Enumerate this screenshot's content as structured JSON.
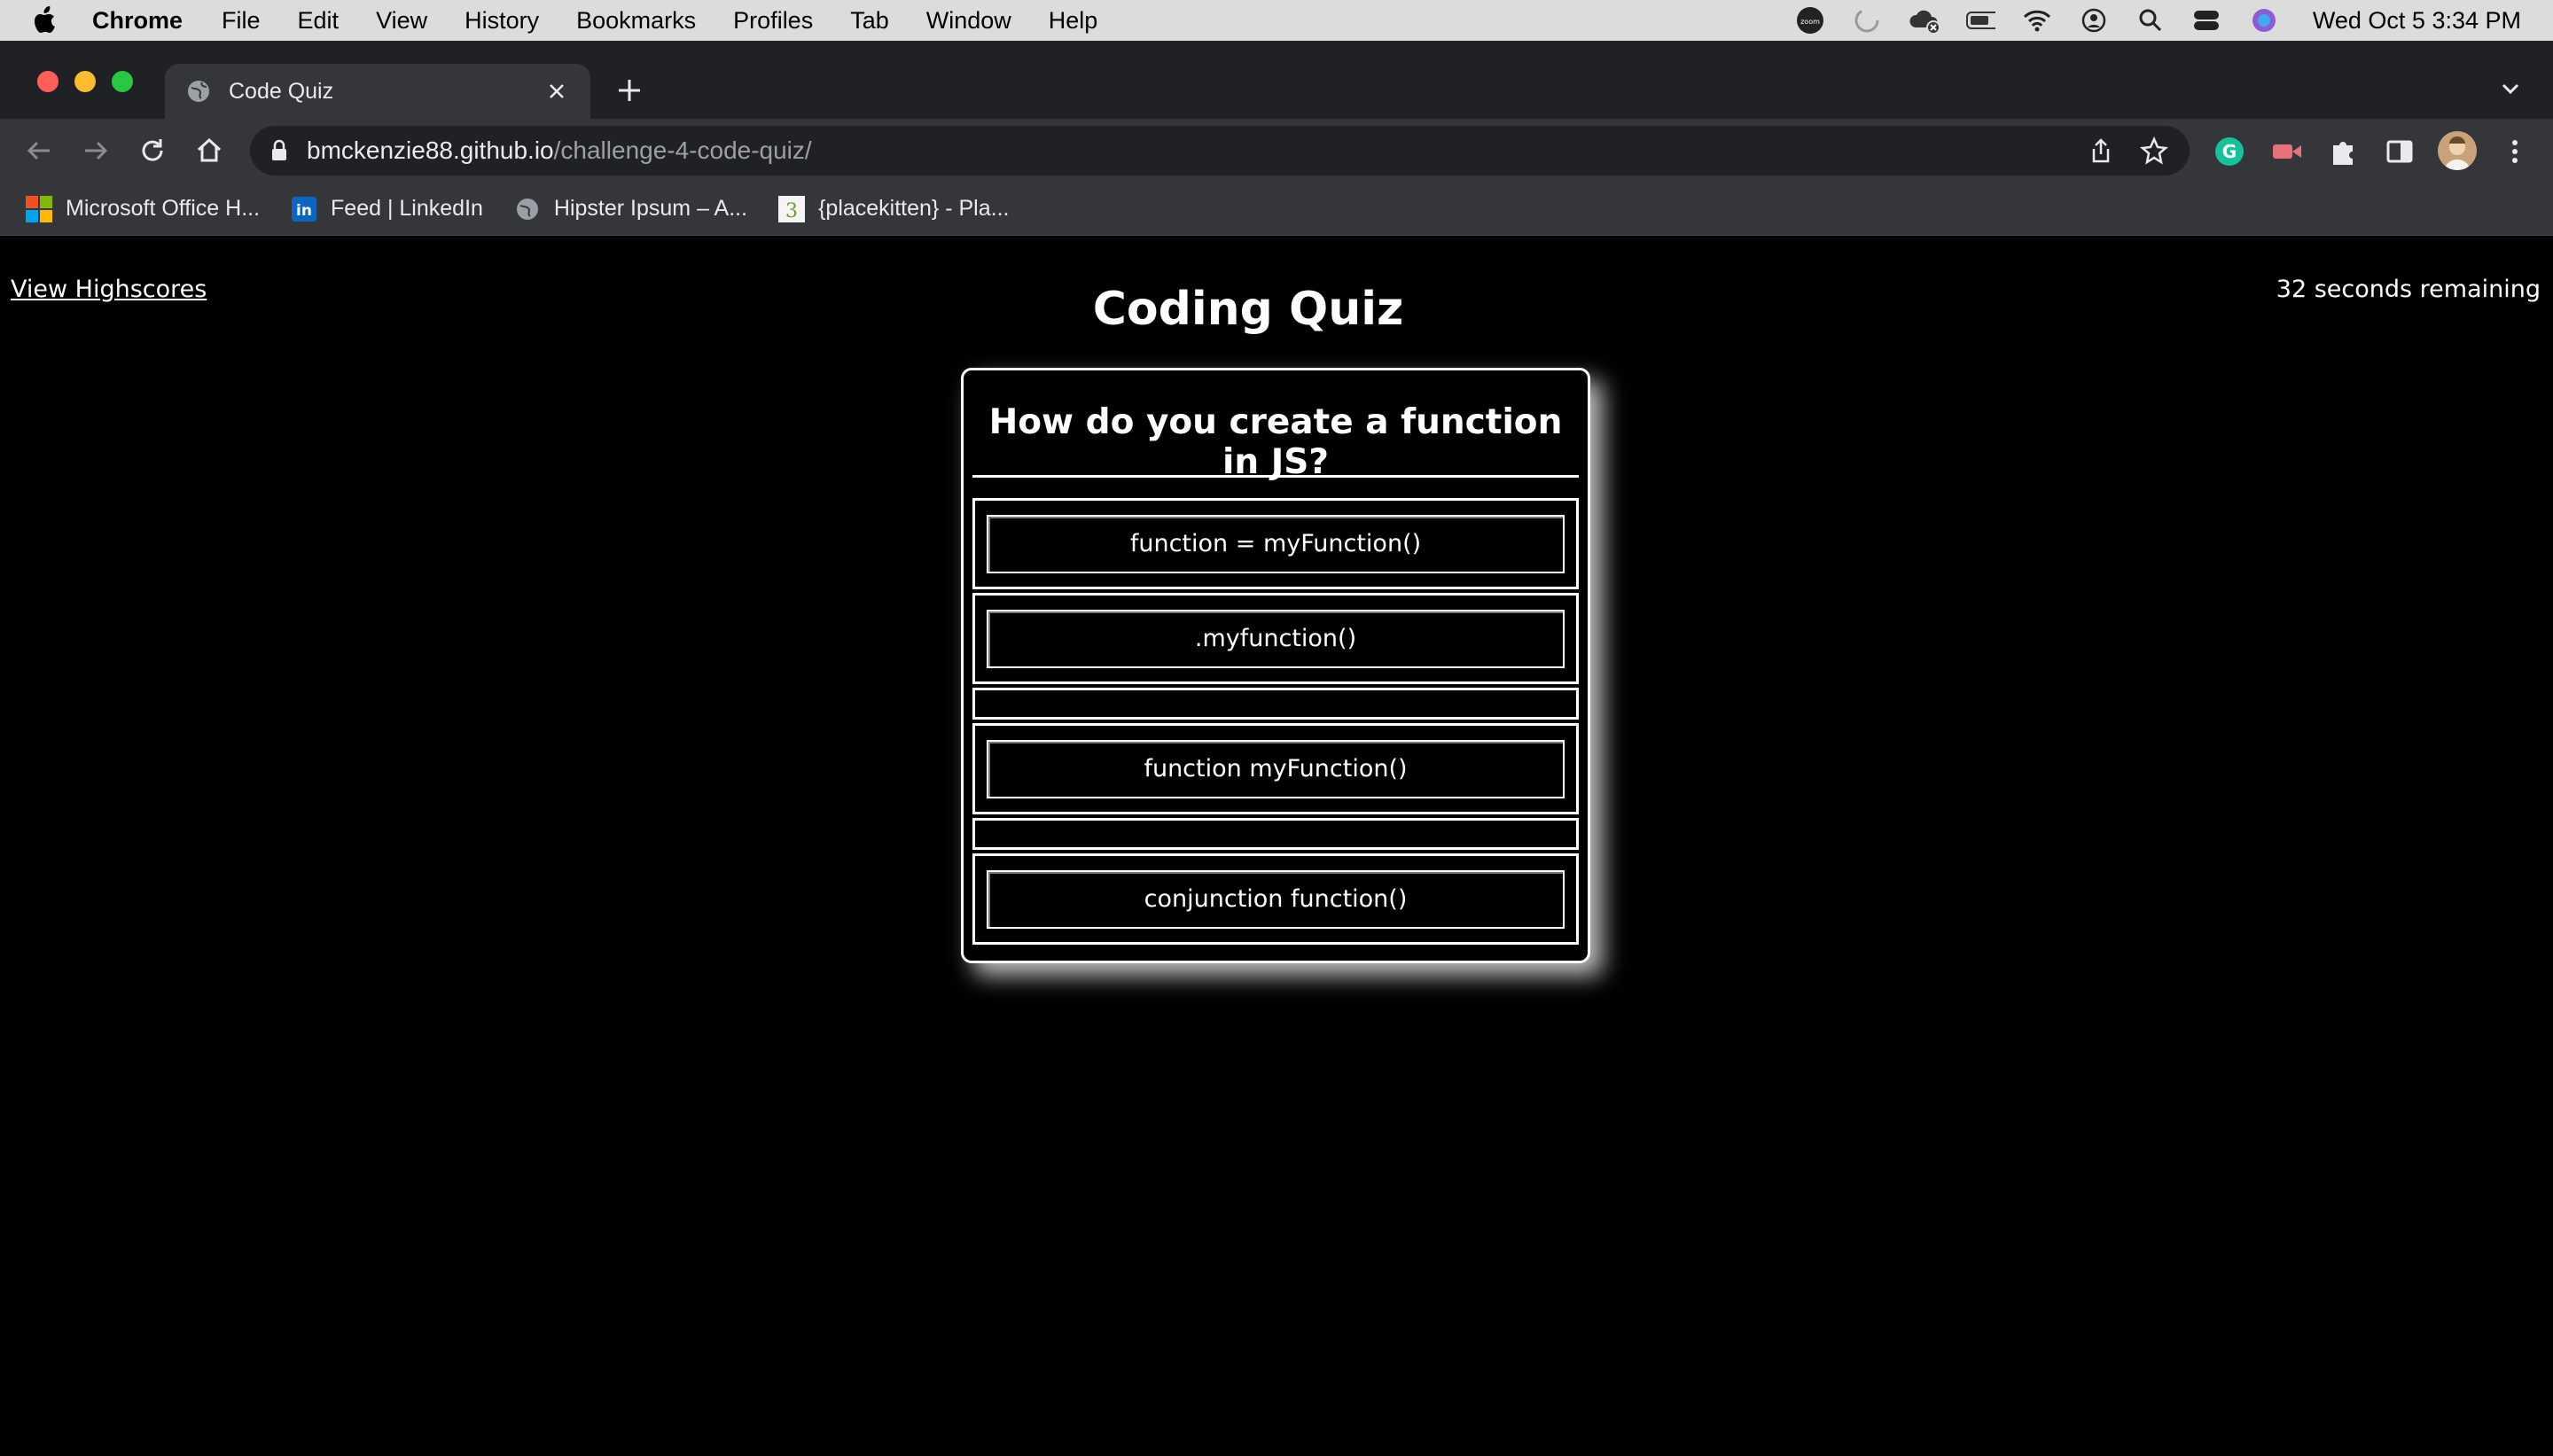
{
  "menubar": {
    "app": "Chrome",
    "items": [
      "File",
      "Edit",
      "View",
      "History",
      "Bookmarks",
      "Profiles",
      "Tab",
      "Window",
      "Help"
    ],
    "clock": "Wed Oct 5  3:34 PM"
  },
  "browser": {
    "tab_title": "Code Quiz",
    "url_host": "bmckenzie88.github.io",
    "url_path": "/challenge-4-code-quiz/",
    "bookmarks": [
      {
        "label": "Microsoft Office H...",
        "icon": "microsoft-icon"
      },
      {
        "label": "Feed | LinkedIn",
        "icon": "linkedin-icon"
      },
      {
        "label": "Hipster Ipsum – A...",
        "icon": "globe-icon"
      },
      {
        "label": "{placekitten} - Pla...",
        "icon": "placekitten-icon"
      }
    ]
  },
  "page": {
    "highscores_link": "View Highscores",
    "title": "Coding Quiz",
    "timer": "32 seconds remaining",
    "question": "How do you create a function in JS?",
    "answers": [
      "function = myFunction()",
      ".myfunction()",
      "",
      "function myFunction()",
      "",
      "conjunction function()"
    ]
  },
  "colors": {
    "page_bg": "#000000",
    "text": "#ffffff",
    "chrome_dark": "#202124",
    "chrome_toolbar": "#35363a"
  }
}
